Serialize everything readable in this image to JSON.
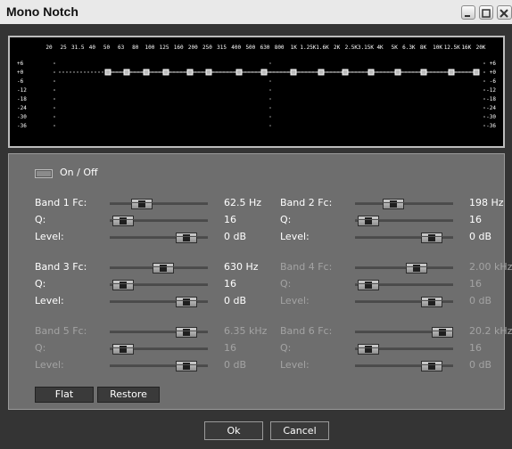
{
  "window": {
    "title": "Mono Notch",
    "controls": [
      "minimize-icon",
      "maximize-icon",
      "close-icon"
    ]
  },
  "eq_display": {
    "freq_labels": [
      "20",
      "25",
      "31.5",
      "40",
      "50",
      "63",
      "80",
      "100",
      "125",
      "160",
      "200",
      "250",
      "315",
      "400",
      "500",
      "630",
      "800",
      "1K",
      "1.25K",
      "1.6K",
      "2K",
      "2.5K",
      "3.15K",
      "4K",
      "5K",
      "6.3K",
      "8K",
      "10K",
      "12.5K",
      "16K",
      "20K"
    ],
    "db_labels_left": [
      "+6",
      "+0",
      "-6",
      "-12",
      "-18",
      "-24",
      "-30",
      "-36"
    ],
    "db_labels_right": [
      "+6",
      "+0",
      "-6",
      "-12",
      "-18",
      "-24",
      "-30",
      "-36"
    ],
    "curve_level_db": 0
  },
  "panel": {
    "toggle": {
      "label": "On / Off"
    },
    "bands": [
      {
        "id": 1,
        "enabled": true,
        "fc_label": "Band 1 Fc:",
        "fc_value": "62.5 Hz",
        "q_label": "Q:",
        "q_value": "16",
        "level_label": "Level:",
        "level_value": "0 dB",
        "fc_pos": 0.28,
        "q_pos": 0.04,
        "level_pos": 0.86
      },
      {
        "id": 2,
        "enabled": true,
        "fc_label": "Band 2 Fc:",
        "fc_value": "198 Hz",
        "q_label": "Q:",
        "q_value": "16",
        "level_label": "Level:",
        "level_value": "0 dB",
        "fc_pos": 0.36,
        "q_pos": 0.04,
        "level_pos": 0.86
      },
      {
        "id": 3,
        "enabled": true,
        "fc_label": "Band 3 Fc:",
        "fc_value": "630 Hz",
        "q_label": "Q:",
        "q_value": "16",
        "level_label": "Level:",
        "level_value": "0 dB",
        "fc_pos": 0.56,
        "q_pos": 0.04,
        "level_pos": 0.86
      },
      {
        "id": 4,
        "enabled": false,
        "fc_label": "Band 4 Fc:",
        "fc_value": "2.00 kHz",
        "q_label": "Q:",
        "q_value": "16",
        "level_label": "Level:",
        "level_value": "0 dB",
        "fc_pos": 0.66,
        "q_pos": 0.04,
        "level_pos": 0.86
      },
      {
        "id": 5,
        "enabled": false,
        "fc_label": "Band 5 Fc:",
        "fc_value": "6.35 kHz",
        "q_label": "Q:",
        "q_value": "16",
        "level_label": "Level:",
        "level_value": "0 dB",
        "fc_pos": 0.86,
        "q_pos": 0.04,
        "level_pos": 0.86
      },
      {
        "id": 6,
        "enabled": false,
        "fc_label": "Band 6 Fc:",
        "fc_value": "20.2 kHz",
        "q_label": "Q:",
        "q_value": "16",
        "level_label": "Level:",
        "level_value": "0 dB",
        "fc_pos": 1.0,
        "q_pos": 0.04,
        "level_pos": 0.86
      }
    ],
    "buttons": {
      "flat": "Flat",
      "restore": "Restore"
    }
  },
  "footer": {
    "ok": "Ok",
    "cancel": "Cancel"
  }
}
